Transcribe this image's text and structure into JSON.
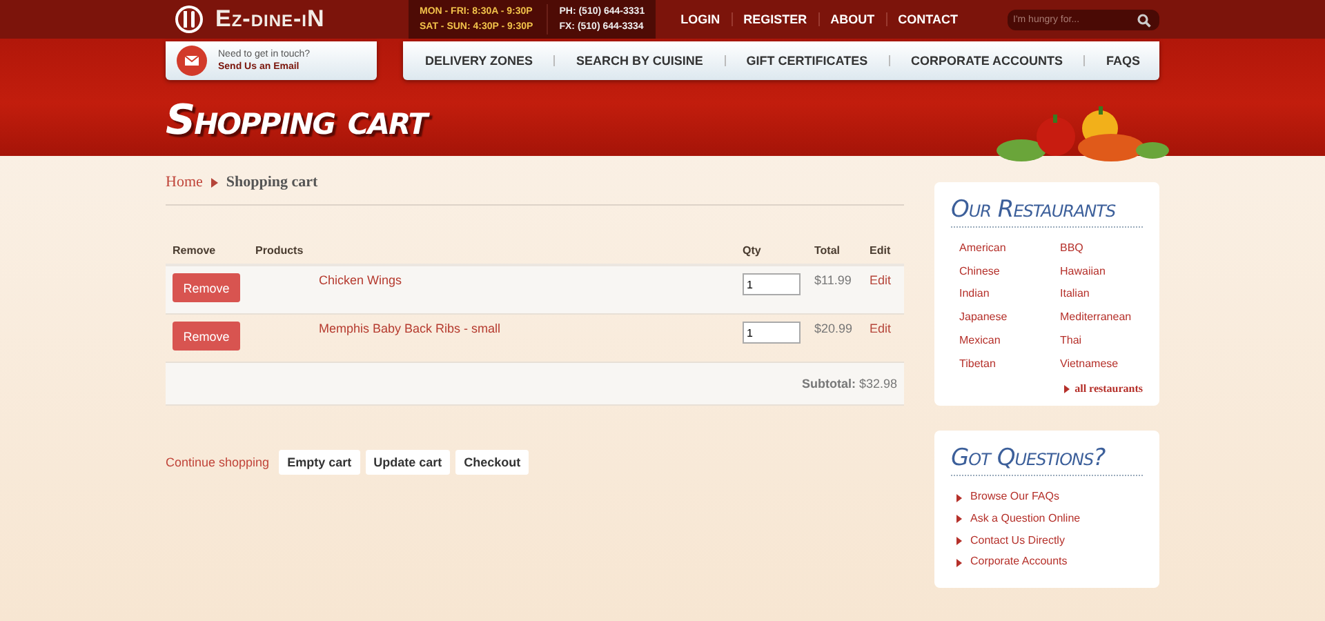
{
  "logo": {
    "text": "Ez-dine-iN"
  },
  "hours": {
    "lines": [
      "MON - FRI: 8:30A - 9:30P",
      "SAT - SUN: 4:30P - 9:30P"
    ],
    "phones": [
      "PH: (510) 644-3331",
      "FX: (510) 644-3334"
    ]
  },
  "top_nav": [
    "LOGIN",
    "REGISTER",
    "ABOUT",
    "CONTACT"
  ],
  "search": {
    "placeholder": "I'm hungry for..."
  },
  "contact_box": {
    "prompt": "Need to get in touch?",
    "link": "Send Us an Email"
  },
  "main_nav": [
    "DELIVERY ZONES",
    "SEARCH BY CUISINE",
    "GIFT CERTIFICATES",
    "CORPORATE ACCOUNTS",
    "FAQS"
  ],
  "page_title": "Shopping cart",
  "breadcrumb": {
    "home": "Home",
    "current": "Shopping cart"
  },
  "table": {
    "columns": [
      "Remove",
      "Products",
      "Qty",
      "Total",
      "Edit"
    ],
    "rows": [
      {
        "remove": "Remove",
        "product": "Chicken Wings",
        "qty": "1",
        "total": "$11.99",
        "edit": "Edit"
      },
      {
        "remove": "Remove",
        "product": "Memphis Baby Back Ribs - small",
        "qty": "1",
        "total": "$20.99",
        "edit": "Edit"
      }
    ],
    "subtotal": "**Subtotal:** $32.98"
  },
  "actions": {
    "continue": "Continue shopping",
    "buttons": [
      "Empty cart",
      "Update cart",
      "Checkout"
    ]
  },
  "restaurants": {
    "title": "Our Restaurants",
    "items": [
      "American",
      "BBQ",
      "Chinese",
      "Hawaiian",
      "Indian",
      "Italian",
      "Japanese",
      "Mediterranean",
      "Mexican",
      "Thai",
      "Tibetan",
      "Vietnamese"
    ],
    "more": "all restaurants"
  },
  "questions": {
    "title": "Got Questions?",
    "items": [
      "Browse Our FAQs",
      "Ask a Question Online",
      "Contact Us Directly",
      "Corporate Accounts"
    ]
  }
}
